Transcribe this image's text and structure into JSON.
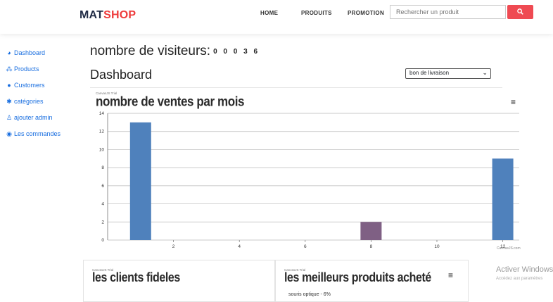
{
  "header": {
    "brand_part1": "MAT",
    "brand_part2": "SHOP",
    "nav": [
      "HOME",
      "PRODUITS",
      "PROMOTION"
    ],
    "search_placeholder": "Rechercher un produit",
    "search_icon": "search-icon"
  },
  "sidebar": {
    "items": [
      {
        "label": "Dashboard",
        "icon": "dashboard-icon"
      },
      {
        "label": "Products",
        "icon": "products-icon"
      },
      {
        "label": "Customers",
        "icon": "user-icon"
      },
      {
        "label": "catégories",
        "icon": "gear-icon"
      },
      {
        "label": "ajouter admin",
        "icon": "user-outline-icon"
      },
      {
        "label": "Les commandes",
        "icon": "globe-icon"
      }
    ]
  },
  "main": {
    "visitors_label": "nombre de visiteurs:",
    "visitors_count": "0 0 0 3 6",
    "dashboard_title": "Dashboard",
    "select_value": "bon de livraison"
  },
  "chart_trial": "CanvasJS Trial",
  "chart_credit": "CanvasJS.com",
  "chart_data": {
    "type": "bar",
    "title": "nombre de ventes par mois",
    "x": [
      1,
      8,
      12
    ],
    "values": [
      13,
      2,
      9
    ],
    "colors": [
      "#4f81bc",
      "#7f6084",
      "#4f81bc"
    ],
    "xlim": [
      0,
      12.5
    ],
    "ylim": [
      0,
      14
    ],
    "yticks": [
      0,
      2,
      4,
      6,
      8,
      10,
      12,
      14
    ],
    "xticks": [
      2,
      4,
      6,
      8,
      10,
      12
    ],
    "grid": true
  },
  "cards": {
    "left_title": "les clients fideles",
    "right_title": "les meilleurs produits acheté",
    "right_item": "souris optique - 6%"
  },
  "watermark": {
    "line1": "Activer Windows",
    "line2": "Accédez aux paramètres"
  }
}
